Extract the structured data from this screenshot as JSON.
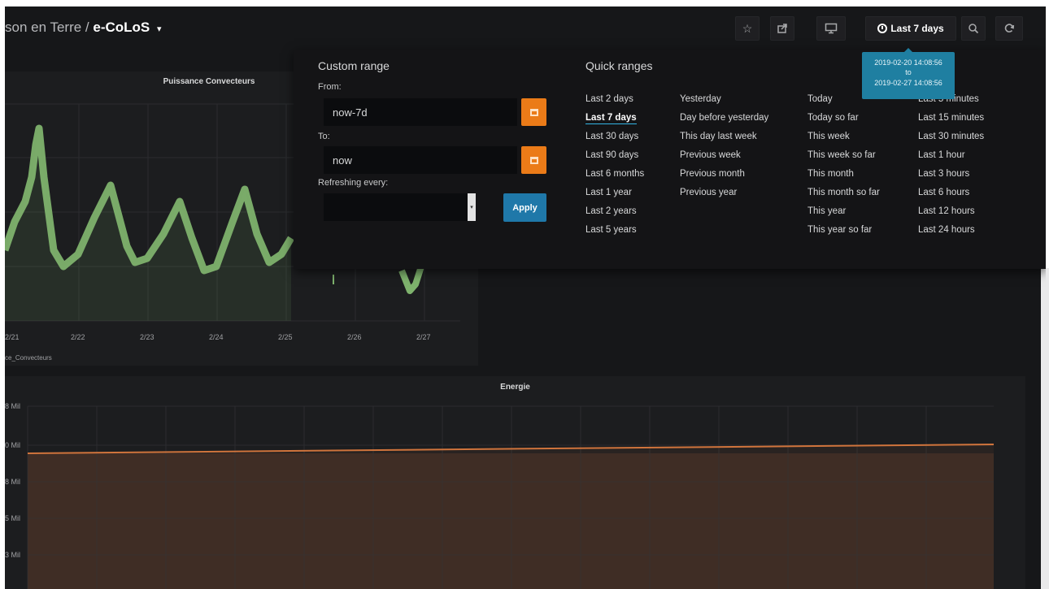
{
  "header": {
    "breadcrumb_folder": "son en Terre /",
    "dashboard_title": "e-CoLoS",
    "caret": "▾"
  },
  "toolbar": {
    "star_icon": "☆",
    "share_icon": "share-icon",
    "tv_icon": "tv-icon",
    "time_range_label": "Last 7 days",
    "zoom_icon": "zoom-out-icon",
    "refresh_icon": "refresh-icon"
  },
  "tooltip": {
    "from": "2019-02-20 14:08:56",
    "to_word": "to",
    "to": "2019-02-27 14:08:56"
  },
  "panels": {
    "puissance": {
      "title": "Puissance Convecteurs",
      "x_ticks": [
        "2/21",
        "2/22",
        "2/23",
        "2/24",
        "2/25",
        "2/26",
        "2/27"
      ],
      "legend": "ce_Convecteurs",
      "line_color": "#7eb26d"
    },
    "energie": {
      "title": "Energie",
      "y_ticks": [
        "8 Mil",
        "0 Mil",
        "8 Mil",
        "5 Mil",
        "3 Mil"
      ],
      "line_color": "#d0743c"
    }
  },
  "timepicker": {
    "custom_range_heading": "Custom range",
    "from_label": "From:",
    "from_value": "now-7d",
    "to_label": "To:",
    "to_value": "now",
    "refreshing_label": "Refreshing every:",
    "refreshing_value": "",
    "apply_label": "Apply",
    "quick_ranges_heading": "Quick ranges",
    "quick_ranges": [
      [
        "Last 2 days",
        "Last 7 days",
        "Last 30 days",
        "Last 90 days",
        "Last 6 months",
        "Last 1 year",
        "Last 2 years",
        "Last 5 years"
      ],
      [
        "Yesterday",
        "Day before yesterday",
        "This day last week",
        "Previous week",
        "Previous month",
        "Previous year"
      ],
      [
        "Today",
        "Today so far",
        "This week",
        "This week so far",
        "This month",
        "This month so far",
        "This year",
        "This year so far"
      ],
      [
        "Last 5 minutes",
        "Last 15 minutes",
        "Last 30 minutes",
        "Last 1 hour",
        "Last 3 hours",
        "Last 6 hours",
        "Last 12 hours",
        "Last 24 hours"
      ]
    ],
    "active_range": "Last 7 days"
  },
  "colors": {
    "accent_blue": "#1f78a9",
    "calendar_orange": "#eb7b18",
    "background": "#161719"
  }
}
